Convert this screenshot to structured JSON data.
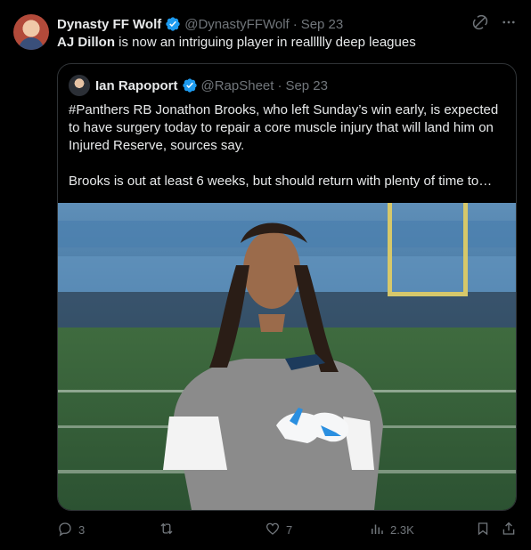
{
  "post": {
    "author_name": "Dynasty FF Wolf",
    "handle": "@DynastyFFWolf",
    "separator": "·",
    "date": "Sep 23",
    "text_bold": "AJ Dillon",
    "text_rest": " is now an intriguing player in reallllly deep leagues"
  },
  "quoted": {
    "author_name": "Ian Rapoport",
    "handle": "@RapSheet",
    "separator": "·",
    "date": "Sep 23",
    "paragraph1": "#Panthers RB Jonathon Brooks, who left Sunday’s win early, is expected to have surgery today to repair a core muscle injury that will land him on Injured Reserve, sources say.",
    "paragraph2": "Brooks is out at least 6 weeks, but should return with plenty of time to…"
  },
  "actions": {
    "replies": "3",
    "reposts": "",
    "likes": "7",
    "views": "2.3K"
  },
  "icons": {
    "verified": "verified-badge-icon",
    "grok": "grok-icon",
    "more": "more-icon",
    "reply": "reply-icon",
    "repost": "repost-icon",
    "like": "like-icon",
    "views": "views-icon",
    "bookmark": "bookmark-icon",
    "share": "share-icon"
  },
  "colors": {
    "background": "#000000",
    "text": "#e7e9ea",
    "muted": "#71767b",
    "verified": "#1d9bf0",
    "border": "#2f3336"
  }
}
